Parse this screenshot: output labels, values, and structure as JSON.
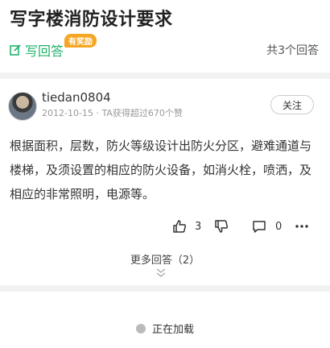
{
  "question": {
    "title": "写字楼消防设计要求"
  },
  "header": {
    "write_label": "写回答",
    "reward_badge": "有奖励",
    "answer_count": "共3个回答"
  },
  "answer": {
    "username": "tiedan0804",
    "date": "2012-10-15",
    "meta_sep": " · ",
    "likes_summary": "TA获得超过670个赞",
    "follow_label": "关注",
    "content": "根据面积，层数，防火等级设计出防火分区，避难通道与楼梯，及须设置的相应的防火设备，如消火栓，喷洒，及相应的非常照明，电源等。",
    "like_count": "3",
    "comment_count": "0"
  },
  "more_answers": "更多回答（2）",
  "loading_text": "正在加载",
  "colors": {
    "accent": "#1fb36a",
    "badge": "#f5a623"
  }
}
